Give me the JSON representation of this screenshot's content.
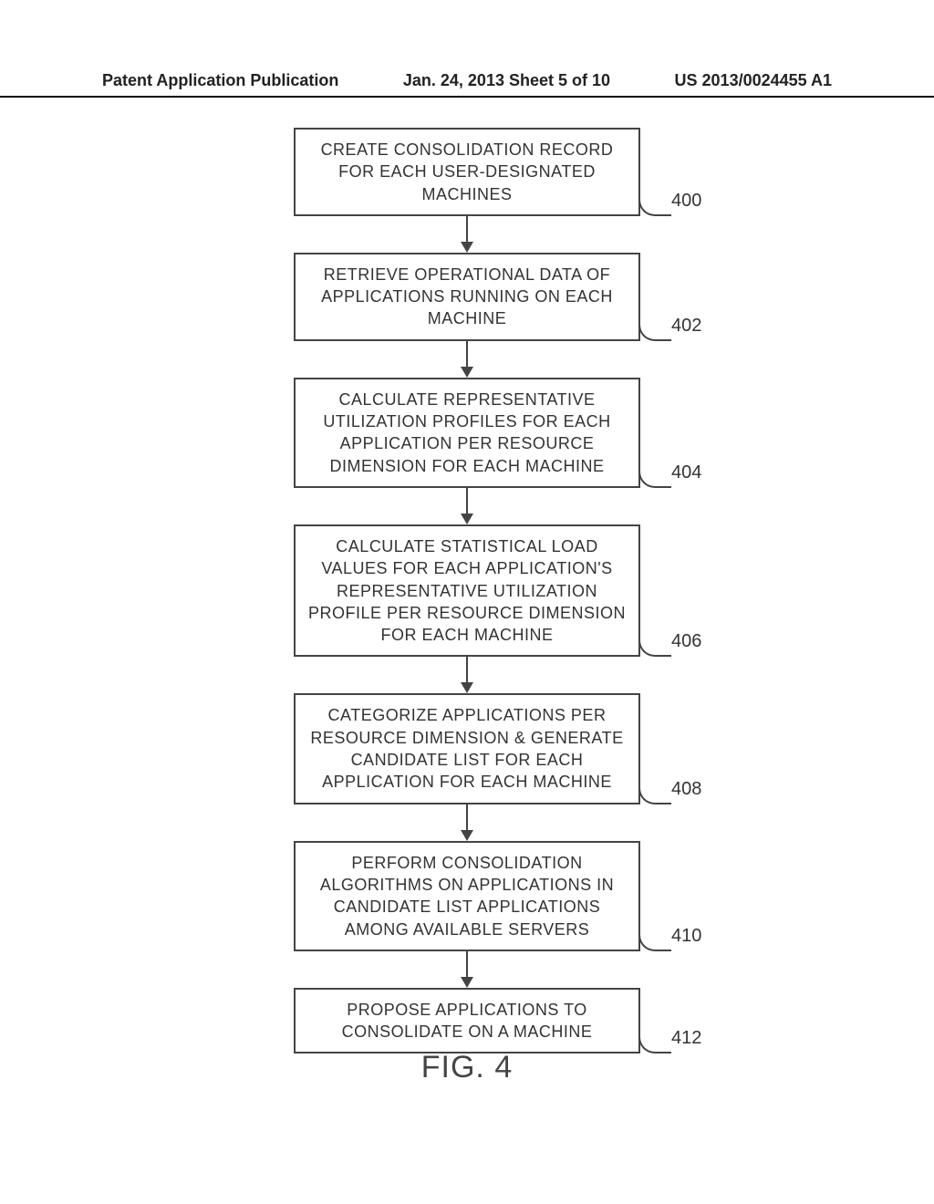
{
  "header": {
    "left": "Patent Application Publication",
    "center": "Jan. 24, 2013  Sheet 5 of 10",
    "right": "US 2013/0024455 A1"
  },
  "flow": {
    "steps": [
      {
        "ref": "400",
        "text": "CREATE CONSOLIDATION RECORD FOR EACH USER-DESIGNATED MACHINES"
      },
      {
        "ref": "402",
        "text": "RETRIEVE OPERATIONAL DATA OF APPLICATIONS RUNNING ON EACH MACHINE"
      },
      {
        "ref": "404",
        "text": "CALCULATE REPRESENTATIVE UTILIZATION PROFILES FOR EACH APPLICATION PER RESOURCE DIMENSION FOR EACH MACHINE"
      },
      {
        "ref": "406",
        "text": "CALCULATE STATISTICAL LOAD VALUES FOR EACH APPLICATION'S REPRESENTATIVE UTILIZATION PROFILE PER RESOURCE DIMENSION FOR EACH MACHINE"
      },
      {
        "ref": "408",
        "text": "CATEGORIZE APPLICATIONS PER RESOURCE DIMENSION & GENERATE CANDIDATE LIST FOR EACH APPLICATION FOR EACH MACHINE"
      },
      {
        "ref": "410",
        "text": "PERFORM CONSOLIDATION ALGORITHMS ON APPLICATIONS IN CANDIDATE LIST APPLICATIONS AMONG AVAILABLE SERVERS"
      },
      {
        "ref": "412",
        "text": "PROPOSE APPLICATIONS TO CONSOLIDATE ON A MACHINE"
      }
    ]
  },
  "figure_label": "FIG. 4"
}
